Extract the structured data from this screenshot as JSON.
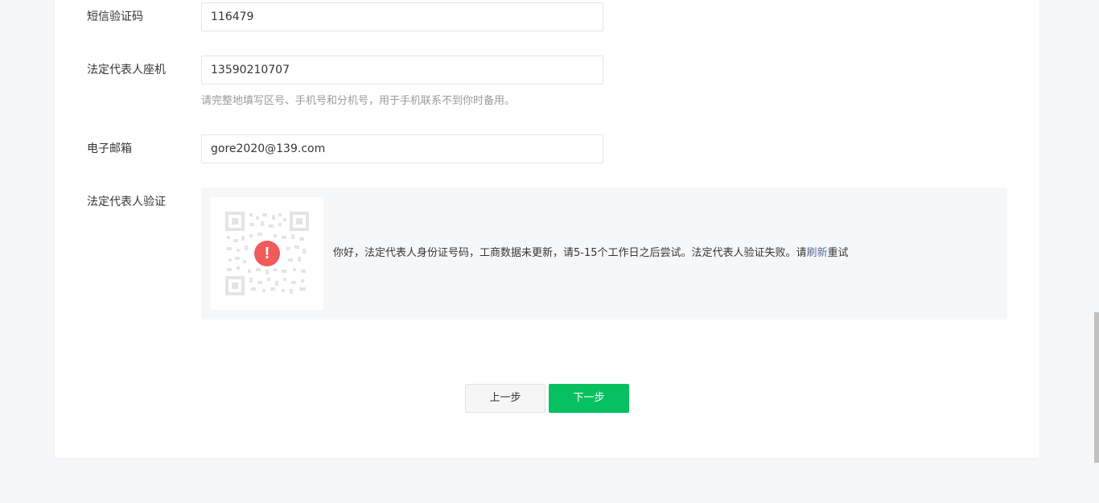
{
  "form": {
    "sms_code": {
      "label": "短信验证码",
      "value": "116479"
    },
    "landline": {
      "label": "法定代表人座机",
      "value": "13590210707",
      "hint": "请完整地填写区号、手机号和分机号，用于手机联系不到你时备用。"
    },
    "email": {
      "label": "电子邮箱",
      "value": "gore2020@139.com"
    },
    "legal_verify": {
      "label": "法定代表人验证",
      "message_before": "你好，法定代表人身份证号码，工商数据未更新，请5-15个工作日之后尝试。法定代表人验证失败。请",
      "refresh_link": "刷新",
      "message_after": "重试",
      "alert_glyph": "!",
      "icon": "alert-icon"
    }
  },
  "actions": {
    "prev_label": "上一步",
    "next_label": "下一步"
  },
  "colors": {
    "primary": "#07c160",
    "alert": "#f05a5a",
    "link": "#576b95",
    "page_bg": "#f6f7f9"
  }
}
